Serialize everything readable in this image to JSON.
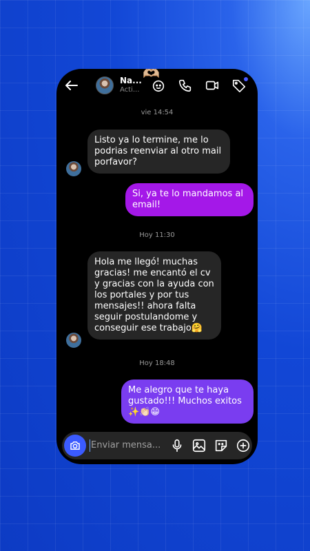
{
  "header": {
    "contact_name": "Na...",
    "contact_status": "Acti...",
    "icons": [
      "back-arrow-icon",
      "sticker-add-icon",
      "phone-icon",
      "video-camera-icon",
      "tag-icon"
    ]
  },
  "messages": [
    {
      "type": "timestamp",
      "text": "vie 14:54"
    },
    {
      "type": "incoming",
      "text": "Listo ya lo termine, me lo podrias reenviar al otro mail porfavor?"
    },
    {
      "type": "outgoing",
      "text": "Si, ya te lo mandamos al email!"
    },
    {
      "type": "timestamp",
      "text": "Hoy 11:30"
    },
    {
      "type": "incoming",
      "text": "Hola me llegó! muchas gracias! me encantó el cv y gracias con la ayuda con los portales y por tus mensajes!! ahora falta seguir postulandome y conseguir ese trabajo🤗"
    },
    {
      "type": "timestamp",
      "text": "Hoy 18:48"
    },
    {
      "type": "outgoing",
      "text": "Me alegro que te haya gustado!!! Muchos exitos ✨👏🏻😁"
    }
  ],
  "composer": {
    "placeholder": "Enviar mensa...",
    "icons": [
      "camera-icon",
      "microphone-icon",
      "image-icon",
      "sticker-icon",
      "plus-icon"
    ]
  },
  "colors": {
    "background": "#1247d6",
    "incoming_bubble": "#262626",
    "outgoing_bubble_1": "#a418e8",
    "outgoing_bubble_2": "#7a3df0",
    "camera_button": "#3b5bff"
  }
}
